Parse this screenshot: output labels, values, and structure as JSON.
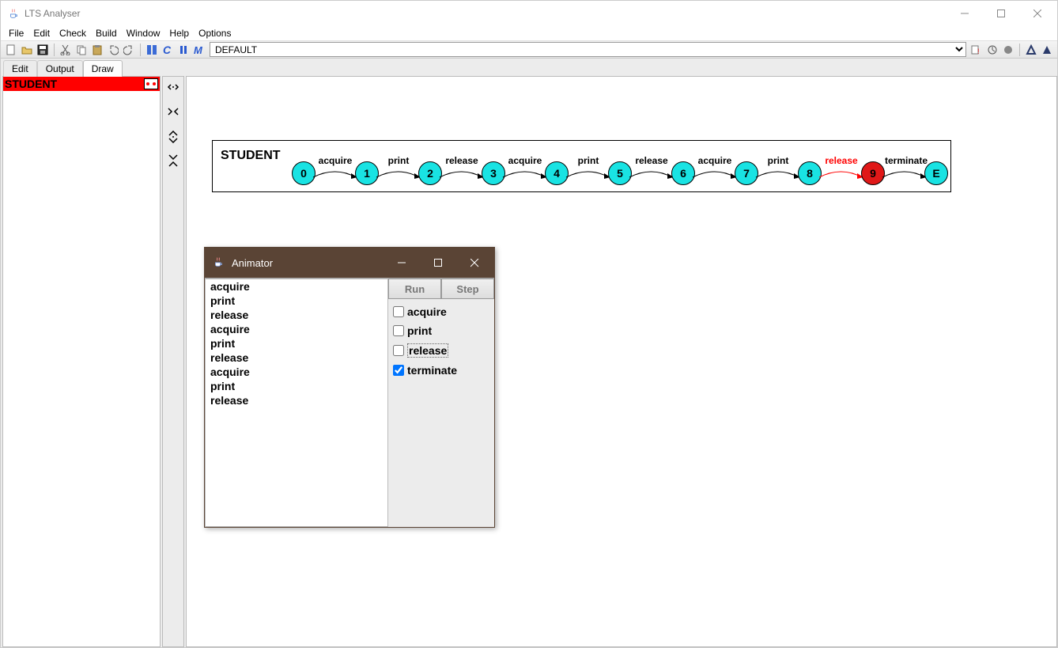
{
  "title": "LTS Analyser",
  "menu": [
    "File",
    "Edit",
    "Check",
    "Build",
    "Window",
    "Help",
    "Options"
  ],
  "toolbar_select": "DEFAULT",
  "tabs": [
    "Edit",
    "Output",
    "Draw"
  ],
  "active_tab": "Draw",
  "left_panel": {
    "model": "STUDENT"
  },
  "diagram": {
    "name": "STUDENT",
    "states": [
      "0",
      "1",
      "2",
      "3",
      "4",
      "5",
      "6",
      "7",
      "8",
      "9",
      "E"
    ],
    "highlight_index": 9,
    "transitions": [
      "acquire",
      "print",
      "release",
      "acquire",
      "print",
      "release",
      "acquire",
      "print",
      "release",
      "terminate"
    ],
    "red_transition_index": 8
  },
  "animator": {
    "title": "Animator",
    "trace": [
      "acquire",
      "print",
      "release",
      "acquire",
      "print",
      "release",
      "acquire",
      "print",
      "release"
    ],
    "buttons": [
      "Run",
      "Step"
    ],
    "checks": [
      {
        "label": "acquire",
        "checked": false
      },
      {
        "label": "print",
        "checked": false
      },
      {
        "label": "release",
        "checked": false,
        "focused": true
      },
      {
        "label": "terminate",
        "checked": true
      }
    ]
  }
}
